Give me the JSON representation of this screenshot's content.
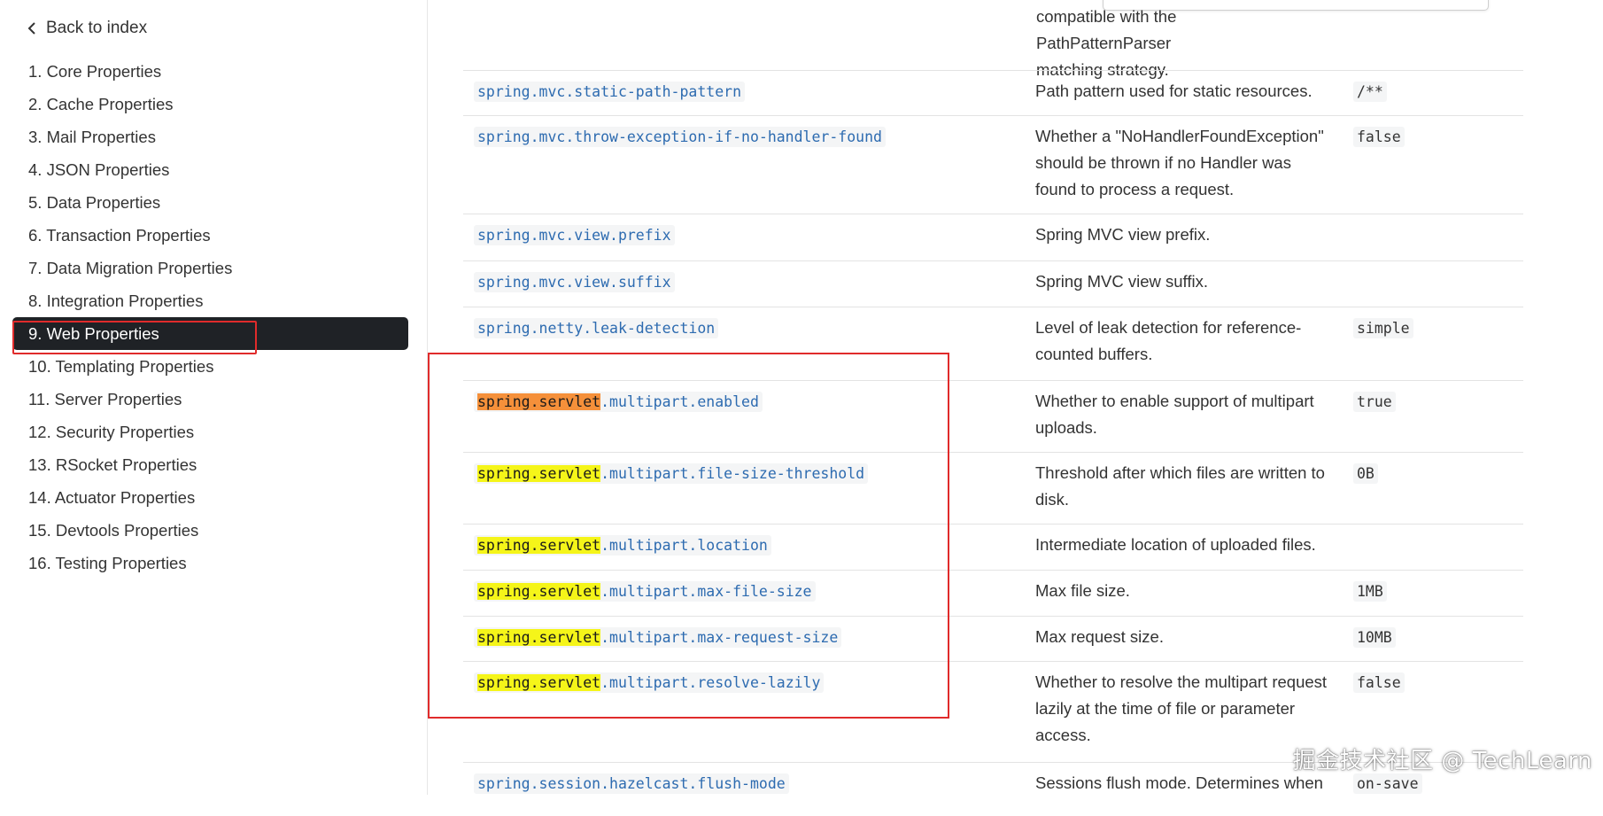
{
  "sidebar": {
    "back_label": "Back to index",
    "items": [
      {
        "label": "1. Core Properties"
      },
      {
        "label": "2. Cache Properties"
      },
      {
        "label": "3. Mail Properties"
      },
      {
        "label": "4. JSON Properties"
      },
      {
        "label": "5. Data Properties"
      },
      {
        "label": "6. Transaction Properties"
      },
      {
        "label": "7. Data Migration Properties"
      },
      {
        "label": "8. Integration Properties"
      },
      {
        "label": "9. Web Properties",
        "active": true
      },
      {
        "label": "10. Templating Properties"
      },
      {
        "label": "11. Server Properties"
      },
      {
        "label": "12. Security Properties"
      },
      {
        "label": "13. RSocket Properties"
      },
      {
        "label": "14. Actuator Properties"
      },
      {
        "label": "15. Devtools Properties"
      },
      {
        "label": "16. Testing Properties"
      }
    ]
  },
  "top_fragment": {
    "line_partial": "custom",
    "line1": "compatible with the PathPatternParser",
    "line2": "matching strategy."
  },
  "search_term": "spring.servlet",
  "table": {
    "rows": [
      {
        "prefix": "",
        "name": "spring.mvc.static-path-pattern",
        "description": "Path pattern used for static resources.",
        "default": "/**"
      },
      {
        "prefix": "",
        "name": "spring.mvc.throw-exception-if-no-handler-found",
        "description": "Whether a \"NoHandlerFoundException\" should be thrown if no Handler was found to process a request.",
        "default": "false"
      },
      {
        "prefix": "",
        "name": "spring.mvc.view.prefix",
        "description": "Spring MVC view prefix.",
        "default": ""
      },
      {
        "prefix": "",
        "name": "spring.mvc.view.suffix",
        "description": "Spring MVC view suffix.",
        "default": ""
      },
      {
        "prefix": "",
        "name": "spring.netty.leak-detection",
        "description": "Level of leak detection for reference-counted buffers.",
        "default": "simple"
      },
      {
        "prefix": "spring.servlet",
        "name": ".multipart.enabled",
        "description": "Whether to enable support of multipart uploads.",
        "default": "true",
        "current_match": true
      },
      {
        "prefix": "spring.servlet",
        "name": ".multipart.file-size-threshold",
        "description": "Threshold after which files are written to disk.",
        "default": "0B"
      },
      {
        "prefix": "spring.servlet",
        "name": ".multipart.location",
        "description": "Intermediate location of uploaded files.",
        "default": ""
      },
      {
        "prefix": "spring.servlet",
        "name": ".multipart.max-file-size",
        "description": "Max file size.",
        "default": "1MB"
      },
      {
        "prefix": "spring.servlet",
        "name": ".multipart.max-request-size",
        "description": "Max request size.",
        "default": "10MB"
      },
      {
        "prefix": "spring.servlet",
        "name": ".multipart.resolve-lazily",
        "description": "Whether to resolve the multipart request lazily at the time of file or parameter access.",
        "default": "false"
      },
      {
        "prefix": "",
        "name": "spring.session.hazelcast.flush-mode",
        "description": "Sessions flush mode. Determines when",
        "default": "on-save"
      }
    ]
  },
  "watermark": "掘金技术社区 @ TechLearn",
  "colors": {
    "active_nav_bg": "#1f2226",
    "highlight": "#f5f519",
    "current_highlight": "#f5903a",
    "annotation_red": "#e02b2b",
    "property_blue": "#2d6bb0"
  }
}
